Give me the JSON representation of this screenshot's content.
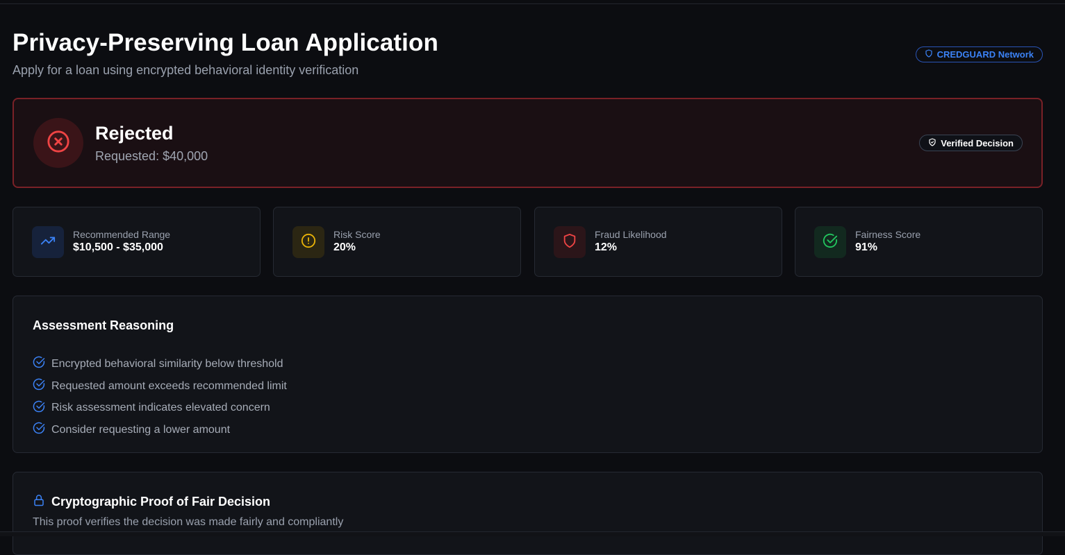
{
  "header": {
    "title": "Privacy-Preserving Loan Application",
    "subtitle": "Apply for a loan using encrypted behavioral identity verification",
    "network_badge": "CREDGUARD Network"
  },
  "decision": {
    "status": "Rejected",
    "requested": "Requested: $40,000",
    "verified_badge": "Verified Decision",
    "status_icon": "x-circle-icon"
  },
  "metrics": [
    {
      "label": "Recommended Range",
      "value": "$10,500 - $35,000",
      "icon": "trending-up-icon",
      "color": "#3b82f6"
    },
    {
      "label": "Risk Score",
      "value": "20%",
      "icon": "alert-circle-icon",
      "color": "#eab308"
    },
    {
      "label": "Fraud Likelihood",
      "value": "12%",
      "icon": "shield-icon",
      "color": "#ef4444"
    },
    {
      "label": "Fairness Score",
      "value": "91%",
      "icon": "check-circle-icon",
      "color": "#22c55e"
    }
  ],
  "reasoning": {
    "title": "Assessment Reasoning",
    "items": [
      "Encrypted behavioral similarity below threshold",
      "Requested amount exceeds recommended limit",
      "Risk assessment indicates elevated concern",
      "Consider requesting a lower amount"
    ]
  },
  "proof": {
    "title": "Cryptographic Proof of Fair Decision",
    "subtitle": "This proof verifies the decision was made fairly and compliantly"
  },
  "colors": {
    "accent": "#3b82f6",
    "rejected": "#ef4444",
    "background": "#0c0d11",
    "card": "#121419"
  }
}
